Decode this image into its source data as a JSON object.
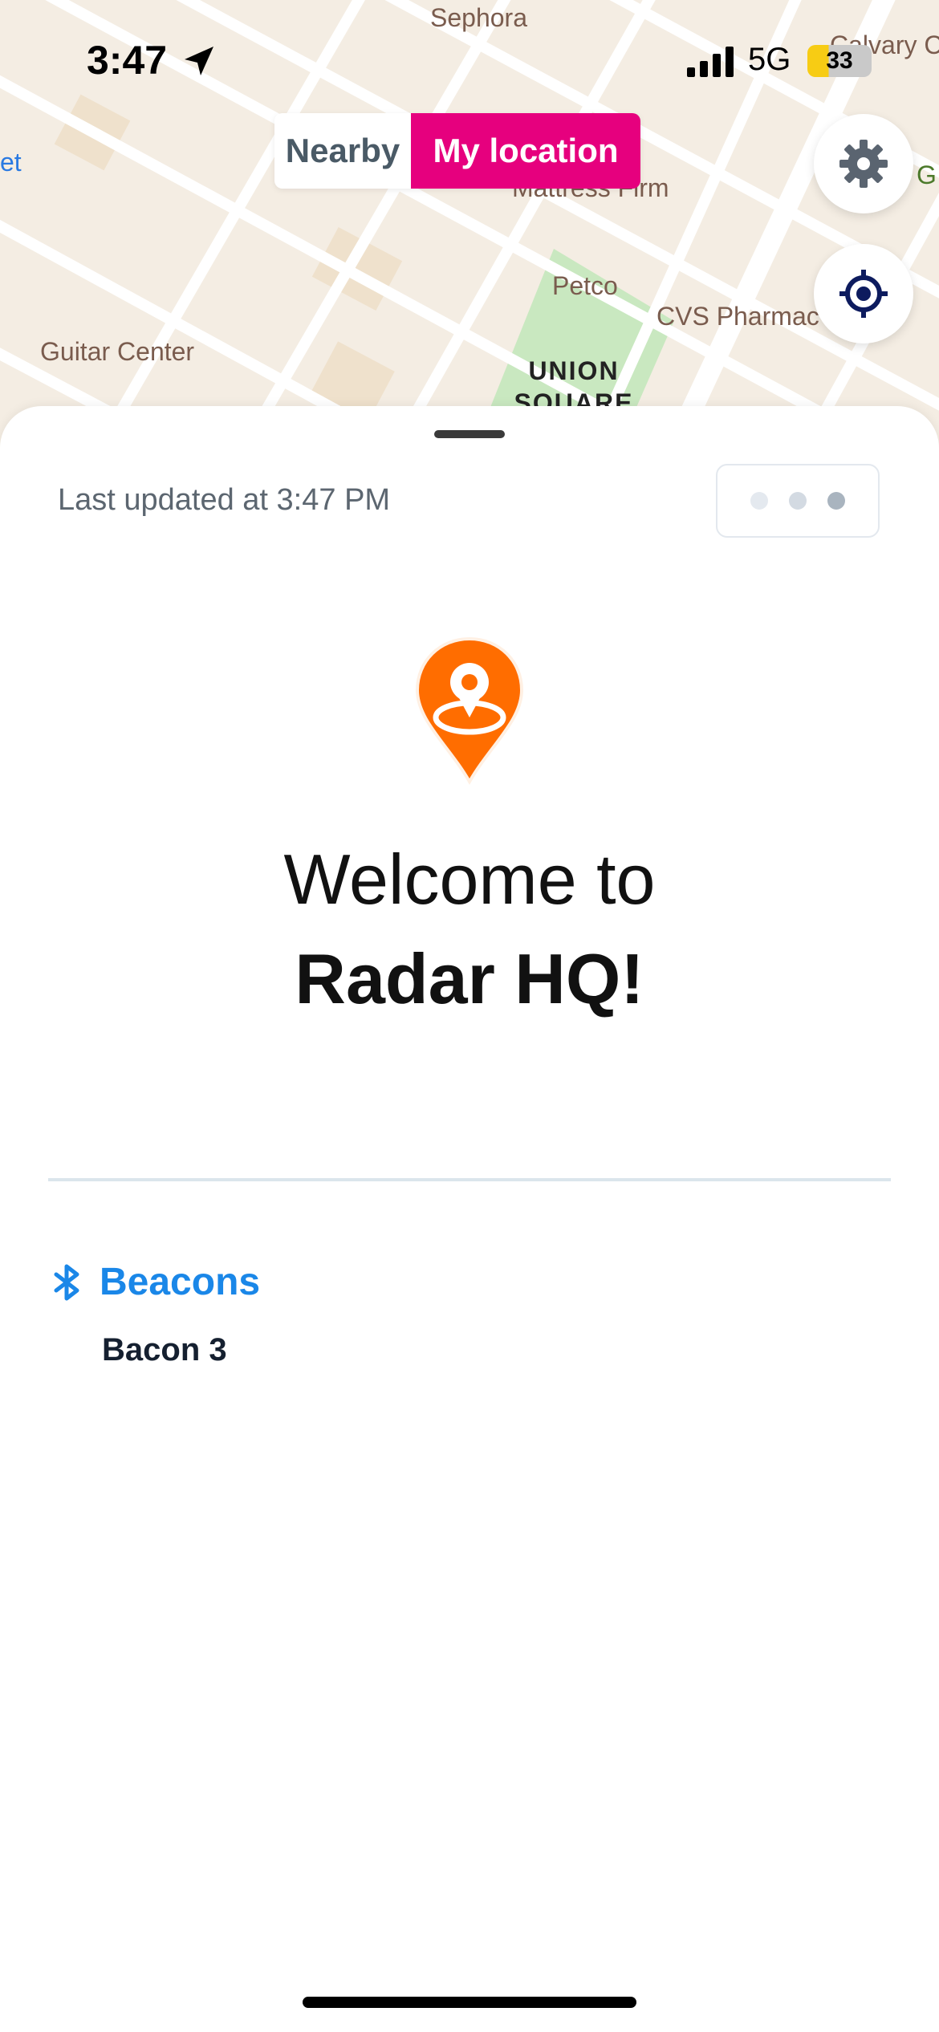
{
  "status_bar": {
    "time": "3:47",
    "network": "5G",
    "battery": "33",
    "battery_level_percent": 33,
    "icons": [
      "location-arrow-icon",
      "signal-bars-icon",
      "battery-icon"
    ]
  },
  "map": {
    "labels": {
      "sephora": "Sephora",
      "calvary": "Calvary C",
      "mattress": "Mattress Firm",
      "petco": "Petco",
      "cvs": "CVS Pharmac",
      "guitar_center": "Guitar Center",
      "park_line1": "UNION",
      "park_line2": "SQUARE",
      "left_edge": "et",
      "right_edge": "G"
    },
    "segmented": {
      "nearby_label": "Nearby",
      "my_location_label": "My location",
      "selected": "My location",
      "active_color": "#e6007e"
    },
    "buttons": {
      "settings_icon": "gear-icon",
      "locate_icon": "crosshair-icon"
    }
  },
  "sheet": {
    "last_updated": "Last updated at 3:47 PM",
    "more_icon": "ellipsis-icon",
    "pin_icon": "map-pin-icon",
    "pin_color": "#ff6d00",
    "welcome_line1": "Welcome to",
    "welcome_line2": "Radar HQ!",
    "beacons": {
      "title": "Beacons",
      "title_color": "#1a87e8",
      "icon": "bluetooth-icon",
      "items": [
        "Bacon 3"
      ]
    }
  }
}
